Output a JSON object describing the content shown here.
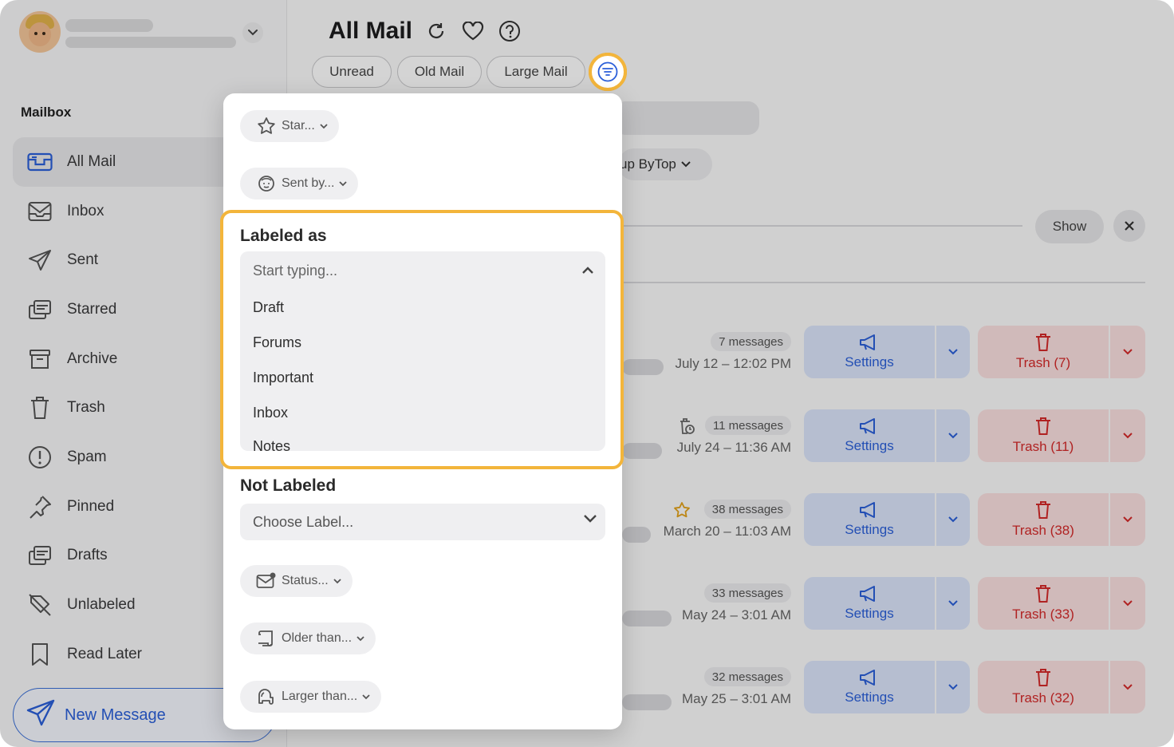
{
  "sidebar": {
    "section_title": "Mailbox",
    "items": [
      {
        "label": "All Mail",
        "icon": "all-mail-icon"
      },
      {
        "label": "Inbox",
        "icon": "inbox-icon"
      },
      {
        "label": "Sent",
        "icon": "sent-icon"
      },
      {
        "label": "Starred",
        "icon": "starred-icon"
      },
      {
        "label": "Archive",
        "icon": "archive-icon"
      },
      {
        "label": "Trash",
        "icon": "trash-icon"
      },
      {
        "label": "Spam",
        "icon": "spam-icon"
      },
      {
        "label": "Pinned",
        "icon": "pin-icon"
      },
      {
        "label": "Drafts",
        "icon": "drafts-icon"
      },
      {
        "label": "Unlabeled",
        "icon": "unlabeled-icon"
      },
      {
        "label": "Read Later",
        "icon": "bookmark-icon"
      }
    ],
    "new_message_label": "New Message"
  },
  "header": {
    "title": "All Mail",
    "chips": [
      "Unread",
      "Old Mail",
      "Large Mail"
    ]
  },
  "toolbar": {
    "group_label": "up ByTop",
    "show_label": "Show"
  },
  "rows": [
    {
      "count": "7 messages",
      "date": "July 12 – 12:02 PM",
      "settings": "Settings",
      "trash": "Trash (7)",
      "extra_icon": ""
    },
    {
      "count": "11 messages",
      "date": "July 24 – 11:36 AM",
      "settings": "Settings",
      "trash": "Trash (11)",
      "extra_icon": "clock-trash-icon"
    },
    {
      "count": "38 messages",
      "date": "March 20 – 11:03 AM",
      "settings": "Settings",
      "trash": "Trash (38)",
      "extra_icon": "star-icon"
    },
    {
      "count": "33 messages",
      "date": "May 24 – 3:01 AM",
      "settings": "Settings",
      "trash": "Trash (33)",
      "extra_icon": ""
    },
    {
      "count": "32 messages",
      "date": "May 25 – 3:01 AM",
      "settings": "Settings",
      "trash": "Trash (32)",
      "extra_icon": ""
    }
  ],
  "filter_panel": {
    "star_label": "Star...",
    "sent_by_label": "Sent by...",
    "labeled_as": {
      "title": "Labeled as",
      "placeholder": "Start typing...",
      "options": [
        "Draft",
        "Forums",
        "Important",
        "Inbox",
        "Notes"
      ]
    },
    "not_labeled": {
      "title": "Not Labeled",
      "select_value": "Choose Label..."
    },
    "status_label": "Status...",
    "older_than_label": "Older than...",
    "larger_than_label": "Larger than..."
  },
  "colors": {
    "accent_blue": "#2b5fd9",
    "danger_red": "#d42a2a",
    "highlight_yellow": "#f3b53b"
  }
}
